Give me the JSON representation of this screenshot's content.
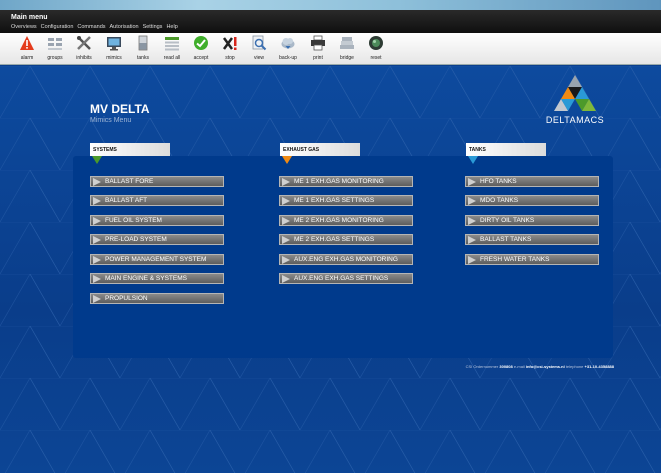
{
  "window": {
    "title": "Main menu",
    "menus": [
      "Overviews",
      "Configuration",
      "Commands",
      "Autorisation",
      "Settings",
      "Help"
    ]
  },
  "toolbar": [
    {
      "label": "alarm",
      "icon": "alarm-icon"
    },
    {
      "label": "groups",
      "icon": "groups-icon"
    },
    {
      "label": "inhibits",
      "icon": "inhibits-icon"
    },
    {
      "label": "mimics",
      "icon": "mimics-icon"
    },
    {
      "label": "tanks",
      "icon": "tanks-icon"
    },
    {
      "label": "read all",
      "icon": "read-all-icon"
    },
    {
      "label": "accept",
      "icon": "accept-icon"
    },
    {
      "label": "stop",
      "icon": "stop-icon"
    },
    {
      "label": "view",
      "icon": "view-icon"
    },
    {
      "label": "back-up",
      "icon": "back-up-icon"
    },
    {
      "label": "print",
      "icon": "print-icon"
    },
    {
      "label": "bridge",
      "icon": "bridge-icon"
    },
    {
      "label": "reset",
      "icon": "reset-icon"
    }
  ],
  "header": {
    "title": "MV DELTA",
    "subtitle": "Mimics Menu"
  },
  "logo": {
    "text": "DELTAMACS"
  },
  "sections": {
    "systems": {
      "label": "SYSTEMS",
      "color": "#4c9a2a",
      "items": [
        "BALLAST FORE",
        "BALLAST AFT",
        "FUEL OIL SYSTEM",
        "PRE-LOAD SYSTEM",
        "POWER MANAGEMENT SYSTEM",
        "MAIN ENGINE & SYSTEMS",
        "PROPULSION"
      ]
    },
    "exhaust": {
      "label": "EXHAUST GAS",
      "color": "#f08a12",
      "items": [
        "ME 1 EXH.GAS MONITORING",
        "ME 1 EXH.GAS SETTINGS",
        "ME 2 EXH.GAS MONITORING",
        "ME 2 EXH.GAS SETTINGS",
        "AUX.ENG EXH.GAS MONITORING",
        "AUX.ENG EXH.GAS SETTINGS"
      ]
    },
    "tanks": {
      "label": "TANKS",
      "color": "#2a9ad6",
      "items": [
        "HFO TANKS",
        "MDO TANKS",
        "DIRTY OIL TANKS",
        "BALLAST TANKS",
        "FRESH WATER TANKS"
      ]
    }
  },
  "footer": {
    "order_label": "CSI Ordernummer",
    "order": "300808",
    "email_label": "e-mail",
    "email": "info@csi-systems.nl",
    "phone_label": "telephone",
    "phone": "+31-10-4358888"
  }
}
